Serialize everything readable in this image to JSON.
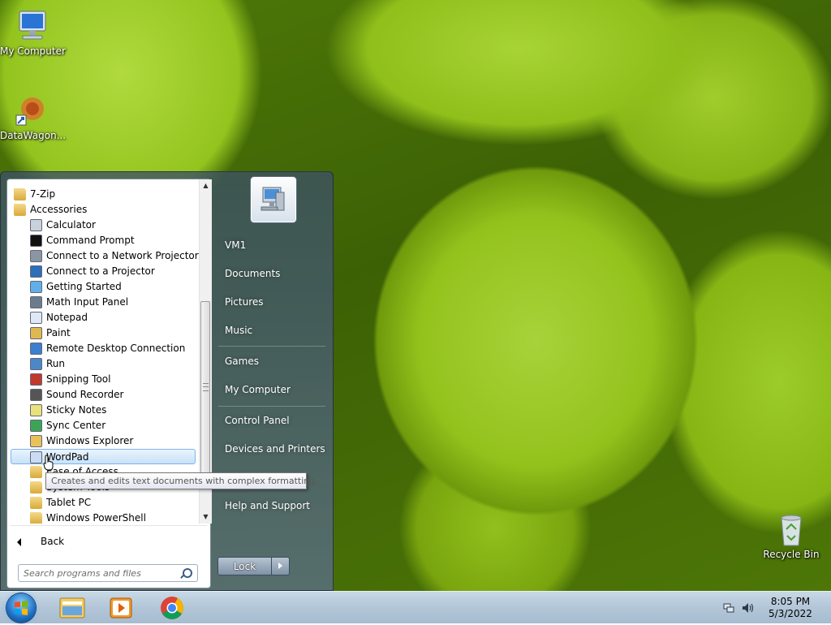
{
  "desktop": {
    "icons": [
      {
        "label": "My Computer"
      },
      {
        "label": "DataWagon..."
      },
      {
        "label": "Recycle Bin"
      }
    ]
  },
  "start_menu": {
    "programs": [
      {
        "label": "7-Zip",
        "icon": "folder-icon",
        "indent": 0
      },
      {
        "label": "Accessories",
        "icon": "folder-icon",
        "indent": 0
      },
      {
        "label": "Calculator",
        "icon": "calculator-icon",
        "indent": 1
      },
      {
        "label": "Command Prompt",
        "icon": "command-prompt-icon",
        "indent": 1
      },
      {
        "label": "Connect to a Network Projector",
        "icon": "network-projector-icon",
        "indent": 1
      },
      {
        "label": "Connect to a Projector",
        "icon": "projector-icon",
        "indent": 1
      },
      {
        "label": "Getting Started",
        "icon": "getting-started-icon",
        "indent": 1
      },
      {
        "label": "Math Input Panel",
        "icon": "math-input-icon",
        "indent": 1
      },
      {
        "label": "Notepad",
        "icon": "notepad-icon",
        "indent": 1
      },
      {
        "label": "Paint",
        "icon": "paint-icon",
        "indent": 1
      },
      {
        "label": "Remote Desktop Connection",
        "icon": "remote-desktop-icon",
        "indent": 1
      },
      {
        "label": "Run",
        "icon": "run-icon",
        "indent": 1
      },
      {
        "label": "Snipping Tool",
        "icon": "scissors-icon",
        "indent": 1
      },
      {
        "label": "Sound Recorder",
        "icon": "microphone-icon",
        "indent": 1
      },
      {
        "label": "Sticky Notes",
        "icon": "sticky-notes-icon",
        "indent": 1
      },
      {
        "label": "Sync Center",
        "icon": "sync-icon",
        "indent": 1
      },
      {
        "label": "Windows Explorer",
        "icon": "explorer-icon",
        "indent": 1
      },
      {
        "label": "WordPad",
        "icon": "wordpad-icon",
        "indent": 1,
        "selected": true
      },
      {
        "label": "Ease of Access",
        "icon": "folder-icon",
        "indent": 1
      },
      {
        "label": "System Tools",
        "icon": "folder-icon",
        "indent": 1
      },
      {
        "label": "Tablet PC",
        "icon": "folder-icon",
        "indent": 1
      },
      {
        "label": "Windows PowerShell",
        "icon": "folder-icon",
        "indent": 1
      }
    ],
    "back_label": "Back",
    "search_placeholder": "Search programs and files",
    "right_links": [
      {
        "label": "VM1"
      },
      {
        "label": "Documents"
      },
      {
        "label": "Pictures"
      },
      {
        "label": "Music"
      },
      {
        "label": "Games"
      },
      {
        "label": "My Computer"
      },
      {
        "label": "Control Panel"
      },
      {
        "label": "Devices and Printers"
      },
      {
        "label": "Help and Support"
      }
    ],
    "lock_label": "Lock",
    "tooltip": "Creates and edits text documents with complex formatting."
  },
  "taskbar": {
    "pinned": [
      "explorer-icon",
      "media-player-icon",
      "chrome-icon"
    ],
    "clock_time": "8:05 PM",
    "clock_date": "5/3/2022"
  }
}
